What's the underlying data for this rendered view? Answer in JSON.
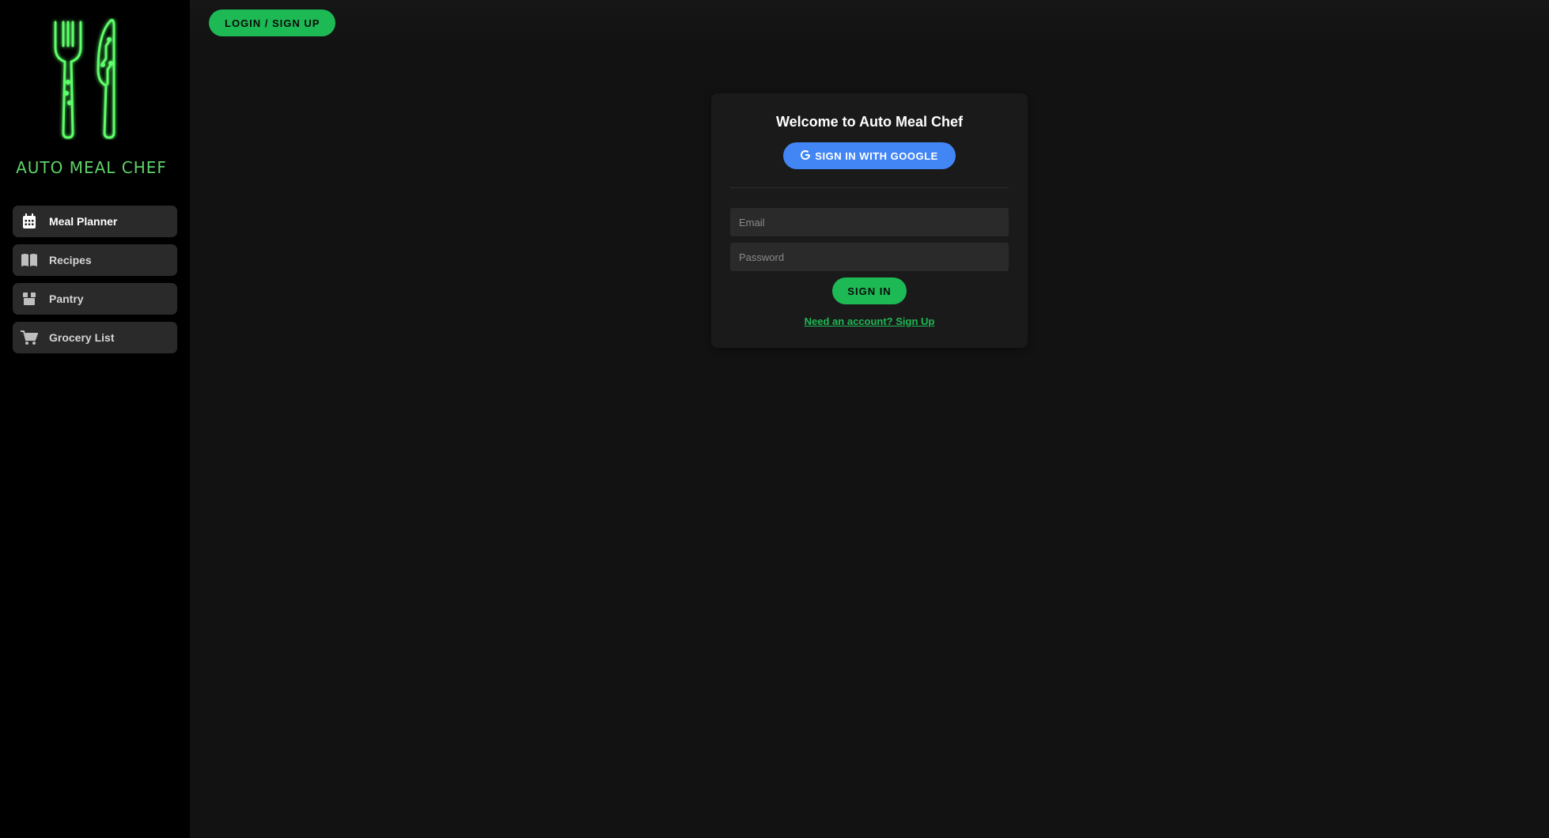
{
  "brand": {
    "name": "AUTO MEAL CHEF",
    "logo_icon": "fork-knife-neon-icon",
    "accent_color": "#5fd36a"
  },
  "sidebar": {
    "items": [
      {
        "label": "Meal Planner",
        "icon": "calendar-icon",
        "active": true
      },
      {
        "label": "Recipes",
        "icon": "open-book-icon",
        "active": false
      },
      {
        "label": "Pantry",
        "icon": "box-icon",
        "active": false
      },
      {
        "label": "Grocery List",
        "icon": "cart-icon",
        "active": false
      }
    ]
  },
  "header": {
    "login_label": "LOGIN / SIGN UP"
  },
  "auth_card": {
    "title": "Welcome to Auto Meal Chef",
    "google_label": "SIGN IN WITH GOOGLE",
    "email_placeholder": "Email",
    "password_placeholder": "Password",
    "signin_label": "SIGN IN",
    "signup_link": "Need an account? Sign Up"
  },
  "colors": {
    "primary_green": "#1db954",
    "google_blue": "#4285f4",
    "sidebar_bg": "#000000",
    "main_bg": "#121212"
  }
}
